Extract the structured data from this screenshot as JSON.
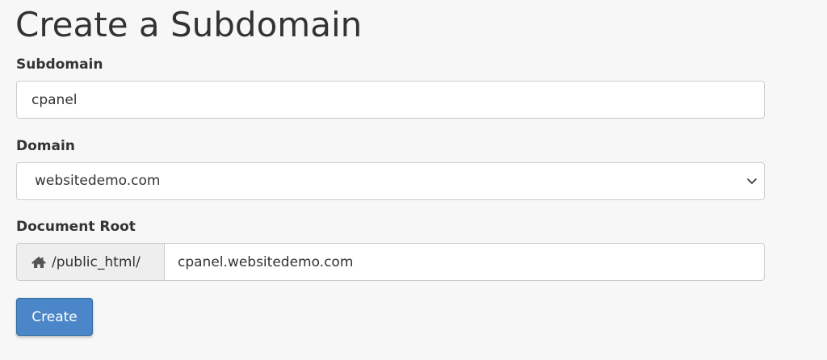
{
  "page": {
    "title": "Create a Subdomain"
  },
  "subdomain": {
    "label": "Subdomain",
    "value": "cpanel"
  },
  "domain": {
    "label": "Domain",
    "selected": "websitedemo.com",
    "icon": "chevron-down-icon"
  },
  "document_root": {
    "label": "Document Root",
    "prefix": "/public_html/",
    "prefix_icon": "home-icon",
    "value": "cpanel.websitedemo.com"
  },
  "actions": {
    "create_label": "Create"
  },
  "colors": {
    "background": "#f7f7f7",
    "primary_button": "#4a86c8",
    "addon_background": "#eeeeee",
    "border": "#cccccc"
  }
}
